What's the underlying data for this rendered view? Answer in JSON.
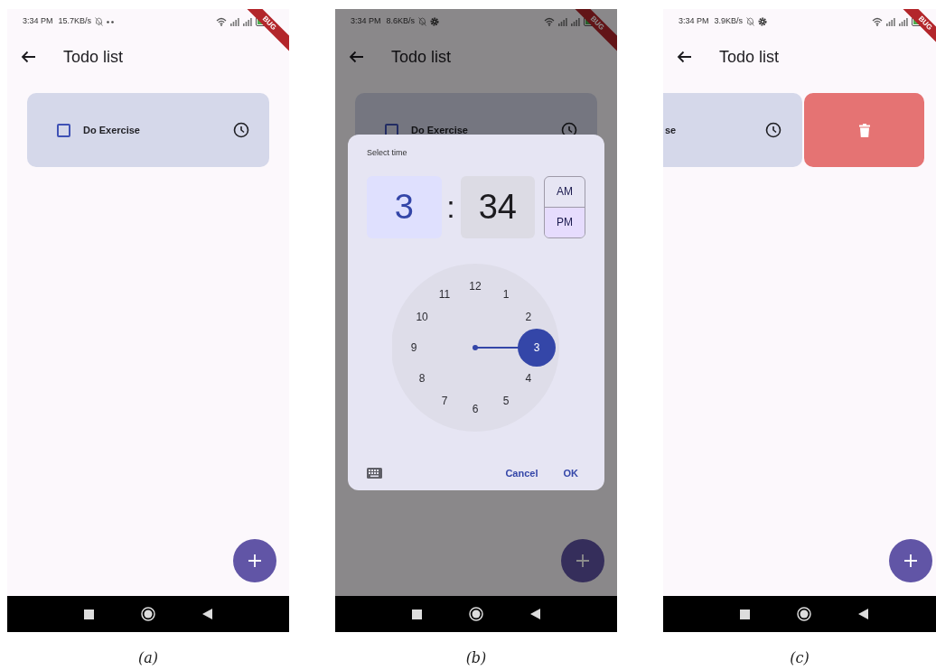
{
  "screens": [
    {
      "caption": "(a)",
      "status_bar": {
        "time": "3:34 PM",
        "speed": "15.7KB/s",
        "indicator": {
          "kind": "dots"
        }
      },
      "debug_banner": "BUG",
      "app_bar": {
        "title": "Todo list"
      },
      "todo": {
        "label": "Do Exercise",
        "checked": false,
        "swiped": false
      }
    },
    {
      "caption": "(b)",
      "status_bar": {
        "time": "3:34 PM",
        "speed": "8.6KB/s",
        "indicator": {
          "kind": "gear"
        }
      },
      "debug_banner": "BUG",
      "app_bar": {
        "title": "Todo list"
      },
      "todo": {
        "label": "Do Exercise",
        "checked": false,
        "swiped": false
      },
      "time_picker": {
        "title": "Select time",
        "fields": [
          {
            "value": "3",
            "selected": true
          },
          {
            "value": "34",
            "selected": false
          }
        ],
        "separator": ":",
        "periods": [
          {
            "label": "AM",
            "selected": false
          },
          {
            "label": "PM",
            "selected": true
          }
        ],
        "dial": [
          {
            "label": "12",
            "selected": false
          },
          {
            "label": "1",
            "selected": false
          },
          {
            "label": "2",
            "selected": false
          },
          {
            "label": "3",
            "selected": true
          },
          {
            "label": "4",
            "selected": false
          },
          {
            "label": "5",
            "selected": false
          },
          {
            "label": "6",
            "selected": false
          },
          {
            "label": "7",
            "selected": false
          },
          {
            "label": "8",
            "selected": false
          },
          {
            "label": "9",
            "selected": false
          },
          {
            "label": "10",
            "selected": false
          },
          {
            "label": "11",
            "selected": false
          }
        ],
        "buttons": [
          "Cancel",
          "OK"
        ]
      }
    },
    {
      "caption": "(c)",
      "status_bar": {
        "time": "3:34 PM",
        "speed": "3.9KB/s",
        "indicator": {
          "kind": "gear"
        }
      },
      "debug_banner": "BUG",
      "app_bar": {
        "title": "Todo list"
      },
      "todo": {
        "label": "se",
        "swiped": true
      }
    }
  ]
}
